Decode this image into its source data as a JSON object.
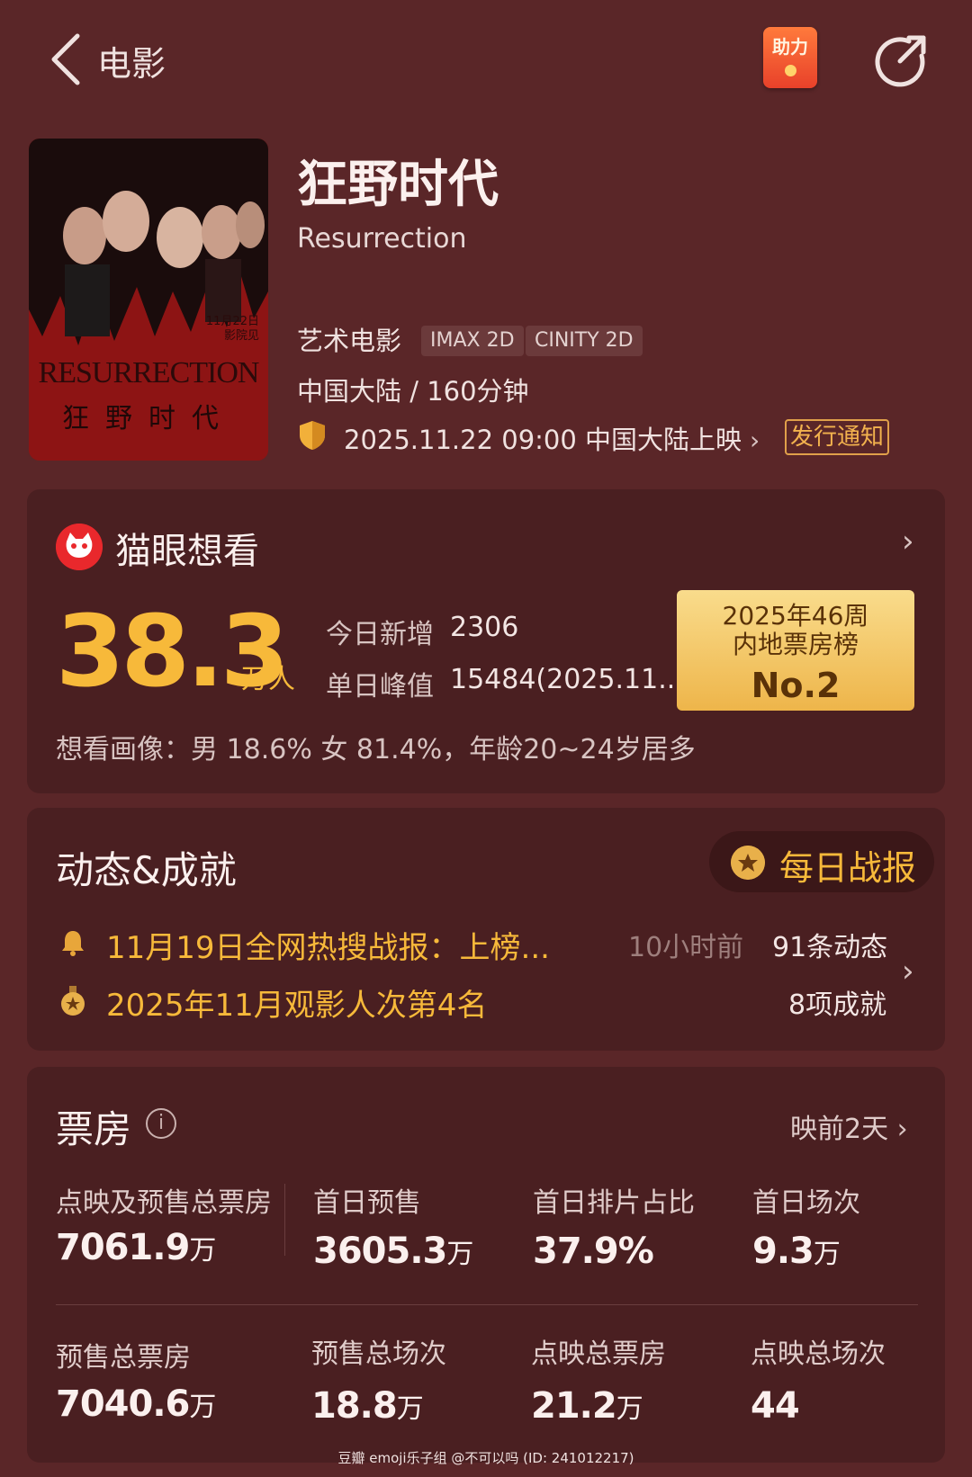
{
  "nav": {
    "back_icon": "chevron-left-icon",
    "title": "电影",
    "help_label": "助力",
    "share_icon": "share-icon"
  },
  "movie": {
    "title": "狂野时代",
    "english_title": "Resurrection",
    "genre": "艺术电影",
    "formats": [
      "IMAX 2D",
      "CINITY 2D"
    ],
    "region_duration": "中国大陆 / 160分钟",
    "release": "2025.11.22 09:00 中国大陆上映",
    "release_notice": "发行通知",
    "poster": {
      "title": "RESURRECTION",
      "cn_title": "狂野时代",
      "date": "11月22日 影院见"
    }
  },
  "want": {
    "label": "猫眼想看",
    "count": "38.3",
    "unit": "万人",
    "today_label": "今日新增",
    "today_value": "2306",
    "peak_label": "单日峰值",
    "peak_value": "15484(2025.11....",
    "rank_line1": "2025年46周",
    "rank_line2": "内地票房榜",
    "rank_value": "No.2",
    "portrait": "想看画像：男 18.6%  女 81.4%，年龄20~24岁居多"
  },
  "news": {
    "title": "动态&成就",
    "daily_label": "每日战报",
    "items": [
      {
        "text": "11月19日全网热搜战报：上榜...",
        "time": "10小时前",
        "count": "91条动态"
      },
      {
        "text": "2025年11月观影人次第4名",
        "count": "8项成就"
      }
    ]
  },
  "box_office": {
    "title": "票房",
    "pre_days": "映前2天",
    "row1": [
      {
        "label": "点映及预售总票房",
        "value": "7061.9",
        "unit": "万"
      },
      {
        "label": "首日预售",
        "value": "3605.3",
        "unit": "万"
      },
      {
        "label": "首日排片占比",
        "value": "37.9%",
        "unit": ""
      },
      {
        "label": "首日场次",
        "value": "9.3",
        "unit": "万"
      }
    ],
    "row2": [
      {
        "label": "预售总票房",
        "value": "7040.6",
        "unit": "万"
      },
      {
        "label": "预售总场次",
        "value": "18.8",
        "unit": "万"
      },
      {
        "label": "点映总票房",
        "value": "21.2",
        "unit": "万"
      },
      {
        "label": "点映总场次",
        "value": "44",
        "unit": ""
      }
    ]
  },
  "watermark": "豆瓣   emoji乐子组 @不可以吗 (ID: 241012217)",
  "colors": {
    "background": "#5a2628",
    "card": "#4a1f21",
    "accent": "#f7b93a"
  }
}
